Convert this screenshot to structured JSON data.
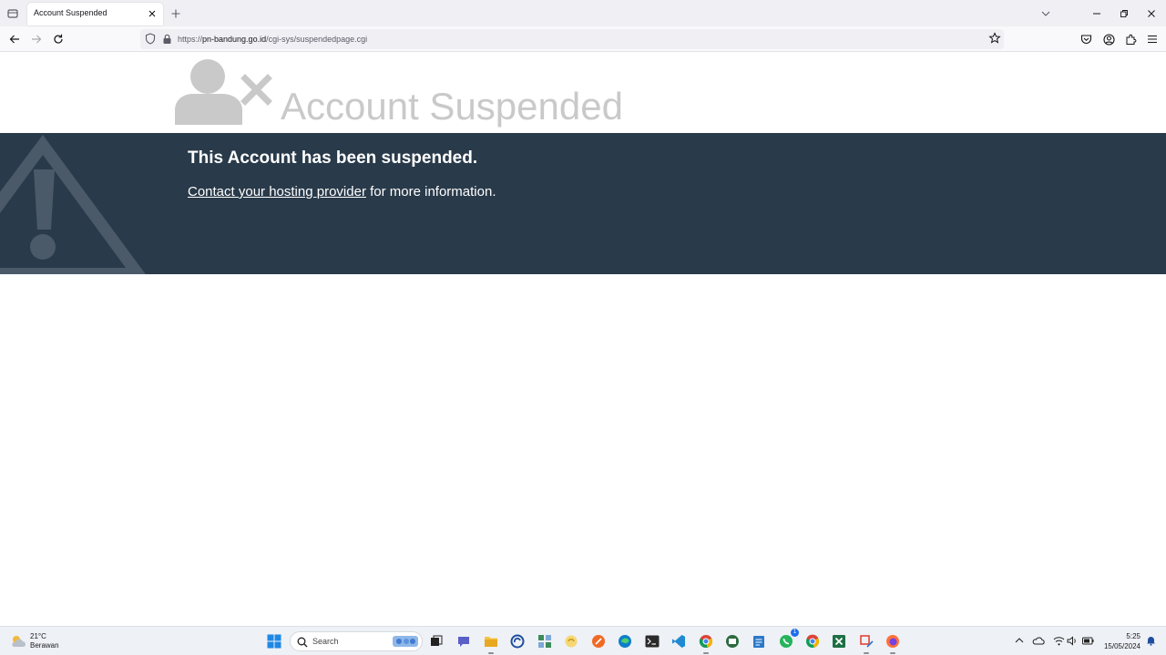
{
  "browser": {
    "tab": {
      "title": "Account Suspended"
    },
    "url": {
      "scheme": "https://",
      "host": "pn-bandung.go.id",
      "path": "/cgi-sys/suspendedpage.cgi"
    }
  },
  "page": {
    "heading": "Account Suspended",
    "banner": {
      "title": "This Account has been suspended.",
      "link_text": "Contact your hosting provider",
      "suffix_text": " for more information."
    },
    "colors": {
      "banner_bg": "#293a4a",
      "heading": "#c9c9c9",
      "icon_gray": "#c9c9c9",
      "warning_shape": "#4a5a69"
    }
  },
  "taskbar": {
    "weather": {
      "temp": "21°C",
      "desc": "Berawan"
    },
    "search": {
      "placeholder": "Search"
    },
    "clock": {
      "time": "5:25",
      "date": "15/05/2024"
    },
    "badges": {
      "whatsapp": "1"
    }
  }
}
